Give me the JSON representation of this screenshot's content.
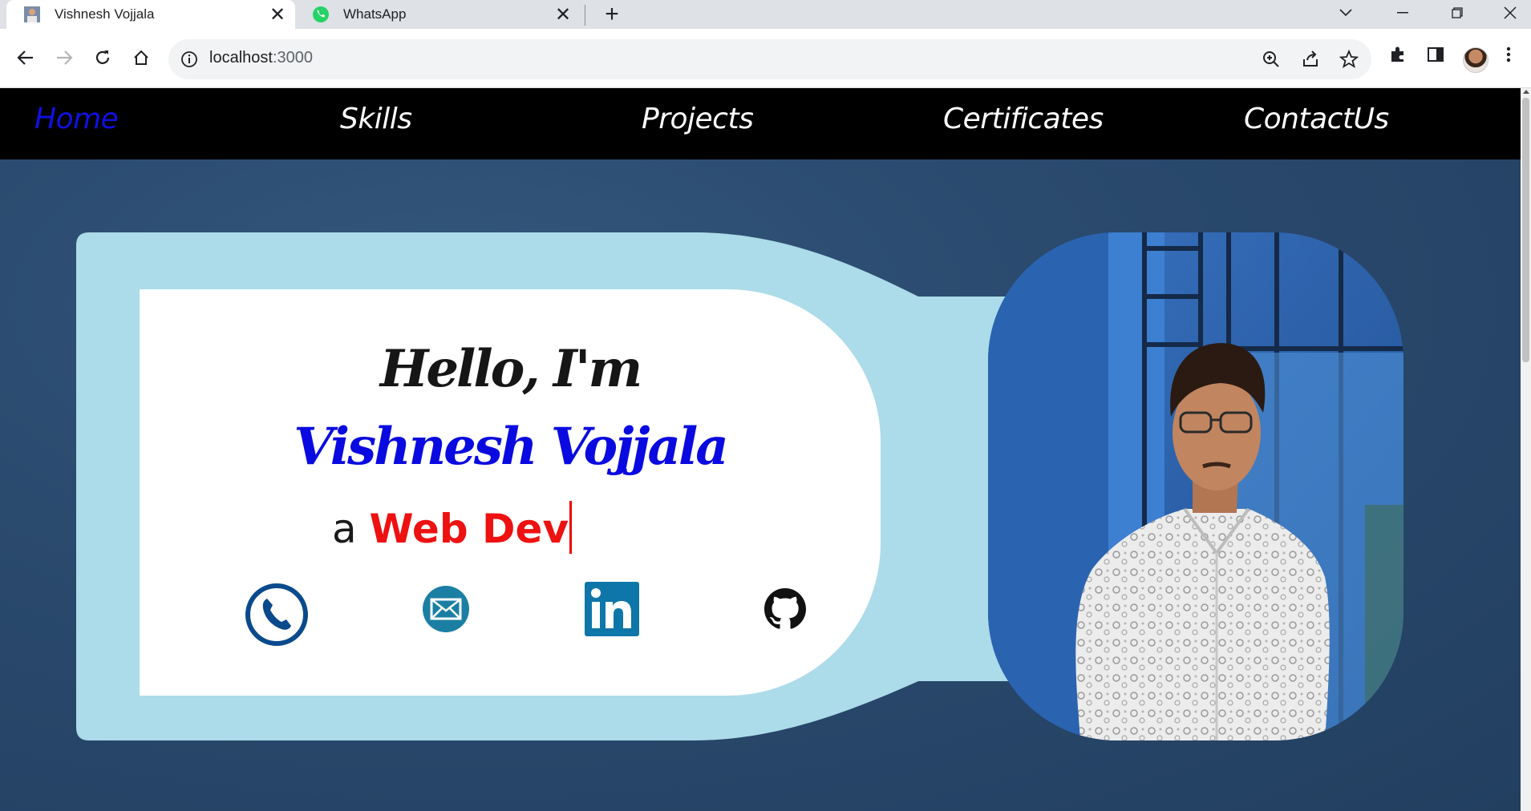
{
  "browser": {
    "tabs": [
      {
        "title": "Vishnesh Vojjala",
        "active": true
      },
      {
        "title": "WhatsApp",
        "active": false
      }
    ],
    "url_host": "localhost",
    "url_port": ":3000"
  },
  "site": {
    "nav": [
      {
        "label": "Home",
        "current": true
      },
      {
        "label": "Skills"
      },
      {
        "label": "Projects"
      },
      {
        "label": "Certificates"
      },
      {
        "label": "ContactUs"
      }
    ],
    "greeting": "Hello, I'm",
    "name": "Vishnesh Vojjala",
    "typing_prefix": "a ",
    "typing_text": "Web Dev",
    "social": [
      "phone-icon",
      "mail-icon",
      "linkedin-icon",
      "github-icon"
    ],
    "colors": {
      "nav_active": "#1010e0",
      "name": "#0a0ae0",
      "typing": "#ee1111",
      "card_bg": "#acdbe9",
      "page_bg": "#2a4a6e"
    }
  }
}
